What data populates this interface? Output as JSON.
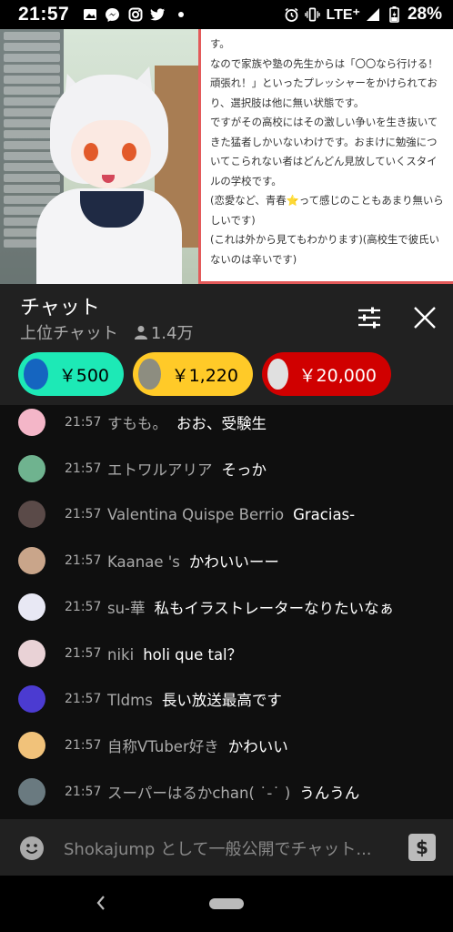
{
  "status_bar": {
    "time": "21:57",
    "icons": [
      "gallery-icon",
      "messenger-icon",
      "instagram-icon",
      "twitter-icon",
      "dot-icon"
    ],
    "network": "LTE⁺",
    "battery": "28%"
  },
  "video": {
    "paper_text": "す。\nなので家族や塾の先生からは「〇〇なら行ける！頑張れ！」といったプレッシャーをかけられており、選択肢は他に無い状態です。\nですがその高校にはその激しい争いを生き抜いてきた猛者しかいないわけです。おまけに勉強についてこられない者はどんどん見放していくスタイルの学校です。\n(恋愛など、青春⭐って感じのこともあまり無いらしいです)\n(これは外から見てもわかります)(高校生で彼氏いないのは辛いです)"
  },
  "chat_header": {
    "title": "チャット",
    "mode": "上位チャット",
    "viewers": "1.4万"
  },
  "super_chats": [
    {
      "amount": "￥500",
      "color": "#1de9b6",
      "avatar_color": "#1565c0"
    },
    {
      "amount": "￥1,220",
      "color": "#ffca28",
      "avatar_color": "#8d8d80"
    },
    {
      "amount": "￥20,000",
      "color": "#d00000",
      "avatar_color": "#e0e0e0"
    }
  ],
  "messages": [
    {
      "time": "21:57",
      "author": "すもも。",
      "text": "おお、受験生",
      "avatar_color": "#f4b6c8"
    },
    {
      "time": "21:57",
      "author": "エトワルアリア",
      "text": "そっか",
      "avatar_color": "#6fb38f"
    },
    {
      "time": "21:57",
      "author": "Valentina Quispe Berrio",
      "text": "Gracias-",
      "avatar_color": "#5a4a48"
    },
    {
      "time": "21:57",
      "author": "Kaanae 's",
      "text": "かわいいーー",
      "avatar_color": "#c9a58a"
    },
    {
      "time": "21:57",
      "author": "su-華",
      "text": "私もイラストレーターなりたいなぁ",
      "avatar_color": "#e8e8f4"
    },
    {
      "time": "21:57",
      "author": "niki",
      "text": "holi que tal？",
      "avatar_color": "#e9d2d6"
    },
    {
      "time": "21:57",
      "author": "Tldms",
      "text": "長い放送最高です",
      "avatar_color": "#4b3bd1"
    },
    {
      "time": "21:57",
      "author": "自称VTuber好き",
      "text": "かわいい",
      "avatar_color": "#f1c27a"
    },
    {
      "time": "21:57",
      "author": "スーパーはるかchan( ˙-˙ )",
      "text": "うんうん",
      "avatar_color": "#6a7a80"
    }
  ],
  "input": {
    "placeholder": "Shokajump として一般公開でチャット..."
  }
}
